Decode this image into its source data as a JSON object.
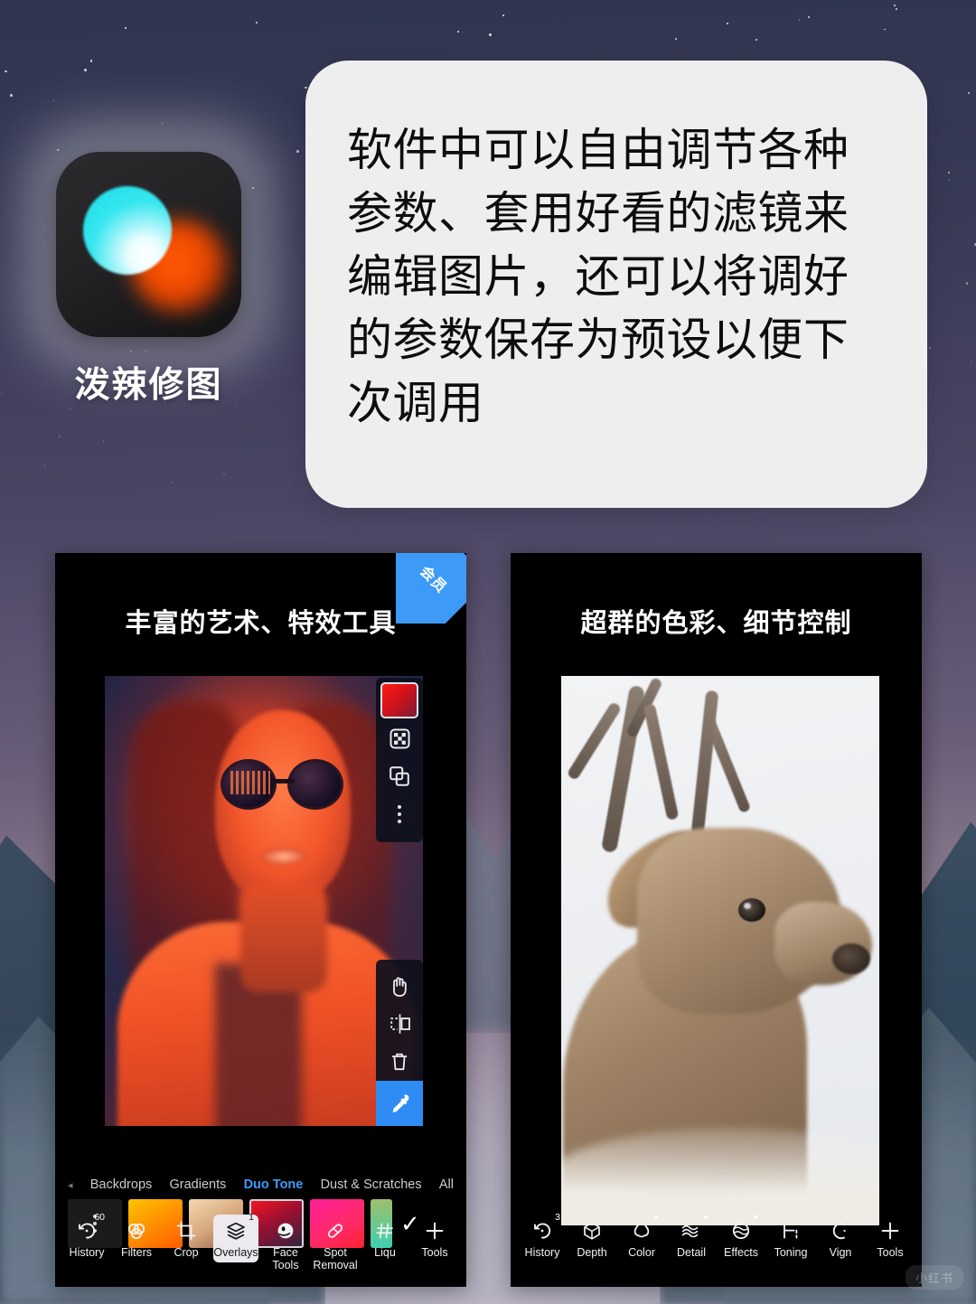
{
  "background": {
    "sky_top_color": "#30354f",
    "sky_bottom_color": "#cdbcbe",
    "mountain_color": "#2e4559"
  },
  "app": {
    "icon_name": "app-icon-polarr",
    "icon_colors": {
      "base": "#1c1c1e",
      "cyan": "#18dbe8",
      "orange": "#ff5a05"
    },
    "name": "泼辣修图"
  },
  "bubble": {
    "text": "软件中可以自由调节各种参数、套用好看的滤镜来编辑图片，还可以将调好的参数保存为预设以便下次调用",
    "background": "#eeeeee"
  },
  "cards": [
    {
      "title": "丰富的艺术、特效工具",
      "ribbon": {
        "label": "会员",
        "color": "#3d9bf7"
      },
      "top_rail": [
        {
          "name": "gradient-swatch",
          "label": "",
          "selected": true
        },
        {
          "name": "mask-checker-icon",
          "label": ""
        },
        {
          "name": "duplicate-layer-icon",
          "label": ""
        },
        {
          "name": "more-options-icon",
          "label": ""
        }
      ],
      "bottom_rail": [
        {
          "name": "hand-pan-icon",
          "label": ""
        },
        {
          "name": "mirror-flip-icon",
          "label": ""
        },
        {
          "name": "delete-trash-icon",
          "label": ""
        },
        {
          "name": "eyedropper-icon",
          "label": "",
          "active": true,
          "color": "#2f8cf5"
        }
      ],
      "categories": [
        {
          "label": "Backdrops",
          "active": false
        },
        {
          "label": "Gradients",
          "active": false
        },
        {
          "label": "Duo Tone",
          "active": true
        },
        {
          "label": "Dust & Scratches",
          "active": false
        },
        {
          "label": "All",
          "active": false
        }
      ],
      "active_category_color": "#3d9bf7",
      "swatches": [
        {
          "name": "more-swatches",
          "colors": [
            "#1b1b1d"
          ]
        },
        {
          "name": "swatch-orange",
          "colors": [
            "#ffc400",
            "#ff5a00"
          ]
        },
        {
          "name": "swatch-tan",
          "colors": [
            "#f5d7b0",
            "#8f6148"
          ]
        },
        {
          "name": "swatch-crimson",
          "colors": [
            "#ff1420",
            "#2b2440"
          ],
          "selected": true
        },
        {
          "name": "swatch-magenta",
          "colors": [
            "#ff1f9a",
            "#ff2230"
          ]
        },
        {
          "name": "swatch-teal",
          "colors": [
            "#9fbf6a",
            "#3fd0b0"
          ]
        }
      ],
      "confirm_label": "✓",
      "toolbar": [
        {
          "label": "History",
          "icon": "history-icon",
          "badge": "60"
        },
        {
          "label": "Filters",
          "icon": "filters-icon"
        },
        {
          "label": "Crop",
          "icon": "crop-icon"
        },
        {
          "label": "Overlays",
          "icon": "overlays-icon",
          "badge": "1",
          "selected": true
        },
        {
          "label": "Face\nTools",
          "icon": "face-tools-icon"
        },
        {
          "label": "Spot\nRemoval",
          "icon": "spot-removal-icon"
        },
        {
          "label": "Liqu",
          "icon": "liquify-icon"
        },
        {
          "label": "Tools",
          "icon": "tools-plus-icon"
        }
      ]
    },
    {
      "title": "超群的色彩、细节控制",
      "toolbar": [
        {
          "label": "History",
          "icon": "history-icon",
          "badge": "3"
        },
        {
          "label": "Depth",
          "icon": "depth-cube-icon"
        },
        {
          "label": "Color",
          "icon": "color-drop-icon",
          "dot": true
        },
        {
          "label": "Detail",
          "icon": "detail-waves-icon",
          "dot": true
        },
        {
          "label": "Effects",
          "icon": "effects-sphere-icon",
          "dot": true
        },
        {
          "label": "Toning",
          "icon": "toning-curve-icon"
        },
        {
          "label": "Vign",
          "icon": "vignette-icon"
        },
        {
          "label": "Tools",
          "icon": "tools-plus-icon"
        }
      ]
    }
  ],
  "watermark": {
    "label": "小红书"
  }
}
